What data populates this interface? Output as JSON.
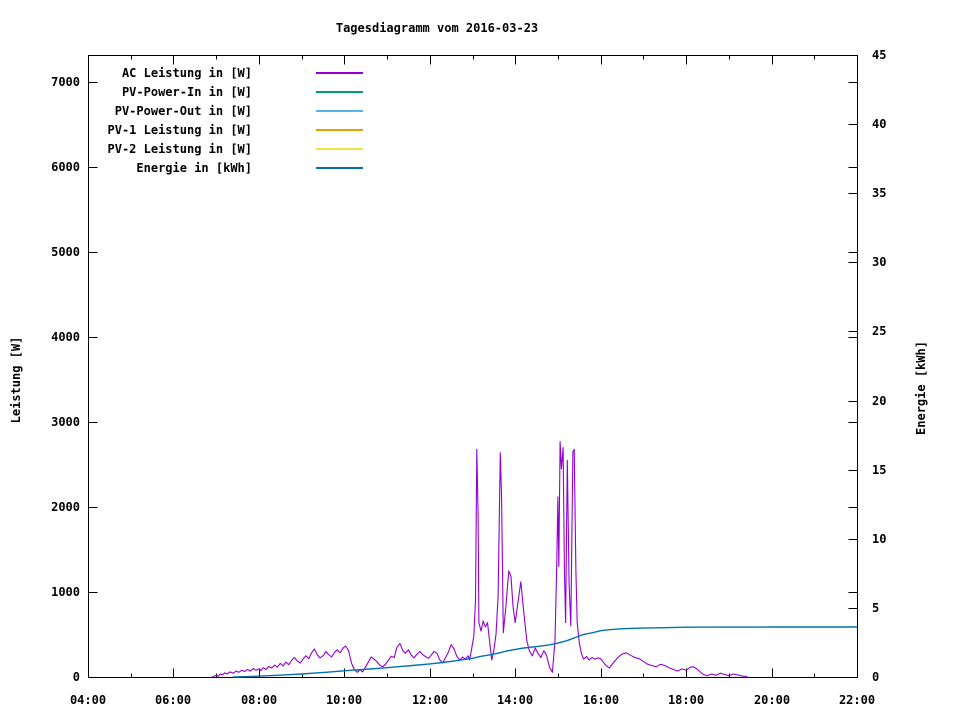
{
  "page": {
    "background": "#ffffff",
    "foreground": "#000000"
  },
  "chart_data": {
    "type": "line",
    "title": "Tagesdiagramm vom 2016-03-23",
    "xlabel": "",
    "ylabel": "Leistung [W]",
    "y2label": "Energie [kWh]",
    "xlim_hours": [
      4,
      22
    ],
    "ylim": [
      0,
      7320
    ],
    "y2lim": [
      0,
      45
    ],
    "grid": false,
    "legend_position": "top-left-inside",
    "x_axis": {
      "major_ticks": [
        {
          "hour": 4,
          "label": "04:00"
        },
        {
          "hour": 6,
          "label": "06:00"
        },
        {
          "hour": 8,
          "label": "08:00"
        },
        {
          "hour": 10,
          "label": "10:00"
        },
        {
          "hour": 12,
          "label": "12:00"
        },
        {
          "hour": 14,
          "label": "14:00"
        },
        {
          "hour": 16,
          "label": "16:00"
        },
        {
          "hour": 18,
          "label": "18:00"
        },
        {
          "hour": 20,
          "label": "20:00"
        },
        {
          "hour": 22,
          "label": "22:00"
        }
      ],
      "minor_tick_hours": [
        5,
        7,
        9,
        11,
        13,
        15,
        17,
        19,
        21
      ]
    },
    "y_axis": {
      "tick_values": [
        0,
        1000,
        2000,
        3000,
        4000,
        5000,
        6000,
        7000
      ]
    },
    "y2_axis": {
      "tick_values": [
        0,
        5,
        10,
        15,
        20,
        25,
        30,
        35,
        40,
        45
      ]
    },
    "series": [
      {
        "name": "AC Leistung in [W]",
        "color": "#9400d3",
        "axis": "y1",
        "points": [
          [
            6.92,
            5
          ],
          [
            7.0,
            20
          ],
          [
            7.05,
            10
          ],
          [
            7.1,
            35
          ],
          [
            7.15,
            25
          ],
          [
            7.2,
            50
          ],
          [
            7.25,
            35
          ],
          [
            7.33,
            60
          ],
          [
            7.4,
            45
          ],
          [
            7.47,
            70
          ],
          [
            7.53,
            55
          ],
          [
            7.6,
            80
          ],
          [
            7.67,
            65
          ],
          [
            7.73,
            90
          ],
          [
            7.8,
            70
          ],
          [
            7.87,
            100
          ],
          [
            7.93,
            80
          ],
          [
            8.0,
            95
          ],
          [
            8.05,
            75
          ],
          [
            8.1,
            110
          ],
          [
            8.17,
            90
          ],
          [
            8.23,
            125
          ],
          [
            8.3,
            105
          ],
          [
            8.37,
            140
          ],
          [
            8.43,
            115
          ],
          [
            8.5,
            160
          ],
          [
            8.57,
            130
          ],
          [
            8.63,
            175
          ],
          [
            8.7,
            145
          ],
          [
            8.77,
            200
          ],
          [
            8.83,
            230
          ],
          [
            8.9,
            190
          ],
          [
            8.97,
            165
          ],
          [
            9.03,
            210
          ],
          [
            9.1,
            250
          ],
          [
            9.17,
            215
          ],
          [
            9.23,
            280
          ],
          [
            9.3,
            330
          ],
          [
            9.37,
            260
          ],
          [
            9.43,
            225
          ],
          [
            9.5,
            250
          ],
          [
            9.57,
            300
          ],
          [
            9.63,
            265
          ],
          [
            9.7,
            235
          ],
          [
            9.77,
            290
          ],
          [
            9.83,
            320
          ],
          [
            9.9,
            285
          ],
          [
            9.97,
            340
          ],
          [
            10.03,
            365
          ],
          [
            10.1,
            310
          ],
          [
            10.17,
            160
          ],
          [
            10.23,
            90
          ],
          [
            10.3,
            55
          ],
          [
            10.37,
            85
          ],
          [
            10.43,
            60
          ],
          [
            10.5,
            120
          ],
          [
            10.57,
            185
          ],
          [
            10.63,
            235
          ],
          [
            10.7,
            210
          ],
          [
            10.77,
            175
          ],
          [
            10.83,
            140
          ],
          [
            10.9,
            120
          ],
          [
            10.97,
            155
          ],
          [
            11.03,
            195
          ],
          [
            11.1,
            245
          ],
          [
            11.17,
            230
          ],
          [
            11.23,
            350
          ],
          [
            11.3,
            395
          ],
          [
            11.37,
            310
          ],
          [
            11.43,
            280
          ],
          [
            11.5,
            320
          ],
          [
            11.57,
            255
          ],
          [
            11.63,
            225
          ],
          [
            11.7,
            270
          ],
          [
            11.77,
            300
          ],
          [
            11.83,
            265
          ],
          [
            11.9,
            240
          ],
          [
            11.97,
            220
          ],
          [
            12.03,
            255
          ],
          [
            12.1,
            300
          ],
          [
            12.17,
            280
          ],
          [
            12.23,
            205
          ],
          [
            12.3,
            165
          ],
          [
            12.37,
            230
          ],
          [
            12.43,
            285
          ],
          [
            12.5,
            380
          ],
          [
            12.57,
            330
          ],
          [
            12.63,
            245
          ],
          [
            12.7,
            200
          ],
          [
            12.77,
            235
          ],
          [
            12.83,
            210
          ],
          [
            12.9,
            250
          ],
          [
            12.93,
            200
          ],
          [
            12.97,
            300
          ],
          [
            13.03,
            480
          ],
          [
            13.07,
            900
          ],
          [
            13.1,
            2680
          ],
          [
            13.13,
            1900
          ],
          [
            13.15,
            640
          ],
          [
            13.2,
            540
          ],
          [
            13.25,
            660
          ],
          [
            13.3,
            590
          ],
          [
            13.35,
            640
          ],
          [
            13.4,
            420
          ],
          [
            13.45,
            200
          ],
          [
            13.5,
            320
          ],
          [
            13.55,
            500
          ],
          [
            13.6,
            950
          ],
          [
            13.65,
            2640
          ],
          [
            13.68,
            2100
          ],
          [
            13.72,
            520
          ],
          [
            13.78,
            820
          ],
          [
            13.85,
            1250
          ],
          [
            13.9,
            1180
          ],
          [
            13.95,
            820
          ],
          [
            14.0,
            640
          ],
          [
            14.07,
            900
          ],
          [
            14.13,
            1120
          ],
          [
            14.2,
            760
          ],
          [
            14.27,
            430
          ],
          [
            14.33,
            310
          ],
          [
            14.4,
            250
          ],
          [
            14.47,
            340
          ],
          [
            14.53,
            280
          ],
          [
            14.6,
            230
          ],
          [
            14.67,
            310
          ],
          [
            14.73,
            260
          ],
          [
            14.8,
            120
          ],
          [
            14.87,
            55
          ],
          [
            14.93,
            430
          ],
          [
            14.97,
            1300
          ],
          [
            15.0,
            2120
          ],
          [
            15.02,
            1300
          ],
          [
            15.05,
            2770
          ],
          [
            15.08,
            2450
          ],
          [
            15.12,
            2700
          ],
          [
            15.15,
            1280
          ],
          [
            15.18,
            640
          ],
          [
            15.22,
            2550
          ],
          [
            15.26,
            1100
          ],
          [
            15.3,
            600
          ],
          [
            15.35,
            2650
          ],
          [
            15.38,
            2680
          ],
          [
            15.42,
            1250
          ],
          [
            15.45,
            640
          ],
          [
            15.5,
            400
          ],
          [
            15.55,
            280
          ],
          [
            15.6,
            210
          ],
          [
            15.67,
            240
          ],
          [
            15.73,
            200
          ],
          [
            15.8,
            230
          ],
          [
            15.87,
            210
          ],
          [
            15.93,
            225
          ],
          [
            16.0,
            215
          ],
          [
            16.1,
            150
          ],
          [
            16.2,
            105
          ],
          [
            16.3,
            170
          ],
          [
            16.4,
            230
          ],
          [
            16.5,
            270
          ],
          [
            16.6,
            285
          ],
          [
            16.7,
            255
          ],
          [
            16.8,
            230
          ],
          [
            16.9,
            215
          ],
          [
            17.0,
            185
          ],
          [
            17.1,
            150
          ],
          [
            17.2,
            135
          ],
          [
            17.3,
            120
          ],
          [
            17.4,
            150
          ],
          [
            17.5,
            135
          ],
          [
            17.6,
            110
          ],
          [
            17.7,
            90
          ],
          [
            17.8,
            70
          ],
          [
            17.9,
            95
          ],
          [
            18.0,
            80
          ],
          [
            18.1,
            115
          ],
          [
            18.17,
            120
          ],
          [
            18.25,
            95
          ],
          [
            18.33,
            60
          ],
          [
            18.4,
            30
          ],
          [
            18.5,
            15
          ],
          [
            18.6,
            35
          ],
          [
            18.7,
            20
          ],
          [
            18.8,
            45
          ],
          [
            18.9,
            30
          ],
          [
            19.0,
            15
          ],
          [
            19.1,
            35
          ],
          [
            19.2,
            25
          ],
          [
            19.33,
            10
          ],
          [
            19.42,
            5
          ]
        ]
      },
      {
        "name": "PV-Power-In in [W]",
        "color": "#009e73",
        "axis": "y1",
        "points": []
      },
      {
        "name": "PV-Power-Out in [W]",
        "color": "#56b4e9",
        "axis": "y1",
        "points": []
      },
      {
        "name": "PV-1 Leistung in [W]",
        "color": "#e69f00",
        "axis": "y1",
        "points": []
      },
      {
        "name": "PV-2 Leistung in [W]",
        "color": "#f0e442",
        "axis": "y1",
        "points": []
      },
      {
        "name": "Energie in [kWh]",
        "color": "#0072b2",
        "axis": "y2",
        "points": [
          [
            7.4,
            0.0
          ],
          [
            7.7,
            0.02
          ],
          [
            8.0,
            0.06
          ],
          [
            8.3,
            0.1
          ],
          [
            8.6,
            0.15
          ],
          [
            9.0,
            0.22
          ],
          [
            9.3,
            0.28
          ],
          [
            9.6,
            0.35
          ],
          [
            10.0,
            0.45
          ],
          [
            10.3,
            0.52
          ],
          [
            10.6,
            0.58
          ],
          [
            11.0,
            0.67
          ],
          [
            11.3,
            0.75
          ],
          [
            11.6,
            0.83
          ],
          [
            12.0,
            0.95
          ],
          [
            12.3,
            1.05
          ],
          [
            12.6,
            1.17
          ],
          [
            13.0,
            1.35
          ],
          [
            13.2,
            1.5
          ],
          [
            13.4,
            1.6
          ],
          [
            13.6,
            1.72
          ],
          [
            13.8,
            1.88
          ],
          [
            14.0,
            2.0
          ],
          [
            14.2,
            2.1
          ],
          [
            14.5,
            2.2
          ],
          [
            14.8,
            2.32
          ],
          [
            15.0,
            2.45
          ],
          [
            15.2,
            2.62
          ],
          [
            15.4,
            2.85
          ],
          [
            15.6,
            3.08
          ],
          [
            15.8,
            3.2
          ],
          [
            16.0,
            3.35
          ],
          [
            16.3,
            3.45
          ],
          [
            16.6,
            3.5
          ],
          [
            17.0,
            3.54
          ],
          [
            17.5,
            3.57
          ],
          [
            18.0,
            3.6
          ],
          [
            19.0,
            3.61
          ],
          [
            20.0,
            3.62
          ],
          [
            21.0,
            3.62
          ],
          [
            22.0,
            3.62
          ]
        ]
      }
    ]
  }
}
